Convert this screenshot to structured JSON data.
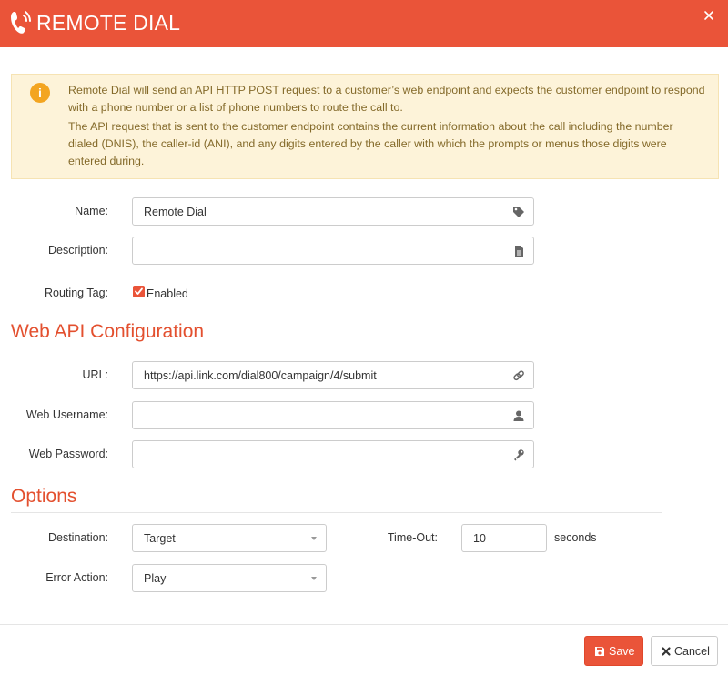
{
  "header": {
    "title": "REMOTE DIAL"
  },
  "alert": {
    "paragraph1": "Remote Dial will send an API HTTP POST request to a customer’s web endpoint and expects the customer endpoint to respond with a phone number or a list of phone numbers to route the call to.",
    "paragraph2": "The API request that is sent to the customer endpoint contains the current information about the call including the number dialed (DNIS), the caller-id (ANI), and any digits entered by the caller with which the prompts or menus those digits were entered during."
  },
  "general": {
    "name_label": "Name:",
    "name_value": "Remote Dial",
    "description_label": "Description:",
    "description_value": "",
    "routing_tag_label": "Routing Tag:",
    "routing_tag_checked": true,
    "routing_tag_option": "Enabled"
  },
  "web_api": {
    "heading": "Web API Configuration",
    "url_label": "URL:",
    "url_value": "https://api.link.com/dial800/campaign/4/submit",
    "username_label": "Web Username:",
    "username_value": "",
    "password_label": "Web Password:",
    "password_value": ""
  },
  "options": {
    "heading": "Options",
    "destination_label": "Destination:",
    "destination_value": "Target",
    "timeout_label": "Time-Out:",
    "timeout_value": "10",
    "timeout_unit": "seconds",
    "error_action_label": "Error Action:",
    "error_action_value": "Play"
  },
  "footer": {
    "save_label": "Save",
    "cancel_label": "Cancel"
  },
  "colors": {
    "accent": "#ea5439",
    "alert_bg": "#fdf3d9",
    "alert_text": "#846a2a",
    "info_icon": "#f3a521"
  },
  "icons": [
    "phone-ringing-icon",
    "close-icon",
    "info-icon",
    "tag-icon",
    "file-icon",
    "link-icon",
    "user-icon",
    "key-icon",
    "floppy-icon",
    "x-icon"
  ]
}
